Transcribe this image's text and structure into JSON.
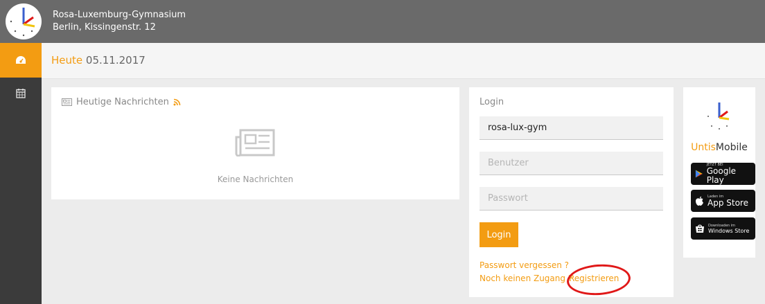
{
  "header": {
    "school_name": "Rosa-Luxemburg-Gymnasium",
    "school_address": "Berlin, Kissingenstr. 12"
  },
  "sidebar": {
    "items": [
      {
        "icon": "dashboard-icon",
        "active": true
      },
      {
        "icon": "calendar-icon",
        "active": false
      }
    ]
  },
  "topbar": {
    "heute_label": "Heute",
    "date": "05.11.2017"
  },
  "news": {
    "title": "Heutige Nachrichten",
    "empty_text": "Keine Nachrichten"
  },
  "login": {
    "title": "Login",
    "school_value": "rosa-lux-gym",
    "user_placeholder": "Benutzer",
    "password_placeholder": "Passwort",
    "button_label": "Login",
    "forgot_password": "Passwort vergessen ?",
    "no_access": "Noch keinen Zugang ?",
    "register": "Registrieren"
  },
  "mobile": {
    "brand_untis": "Untis",
    "brand_mobile": "Mobile",
    "google_play_small": "JETZT BEI",
    "google_play_big": "Google Play",
    "app_store_small": "Laden im",
    "app_store_big": "App Store",
    "windows_small": "Downloaden im",
    "windows_big": "Windows Store"
  },
  "colors": {
    "accent": "#f39c12",
    "header_bg": "#6a6a6a",
    "sidebar_bg": "#3b3b3b",
    "annotation_circle": "#e01818"
  }
}
